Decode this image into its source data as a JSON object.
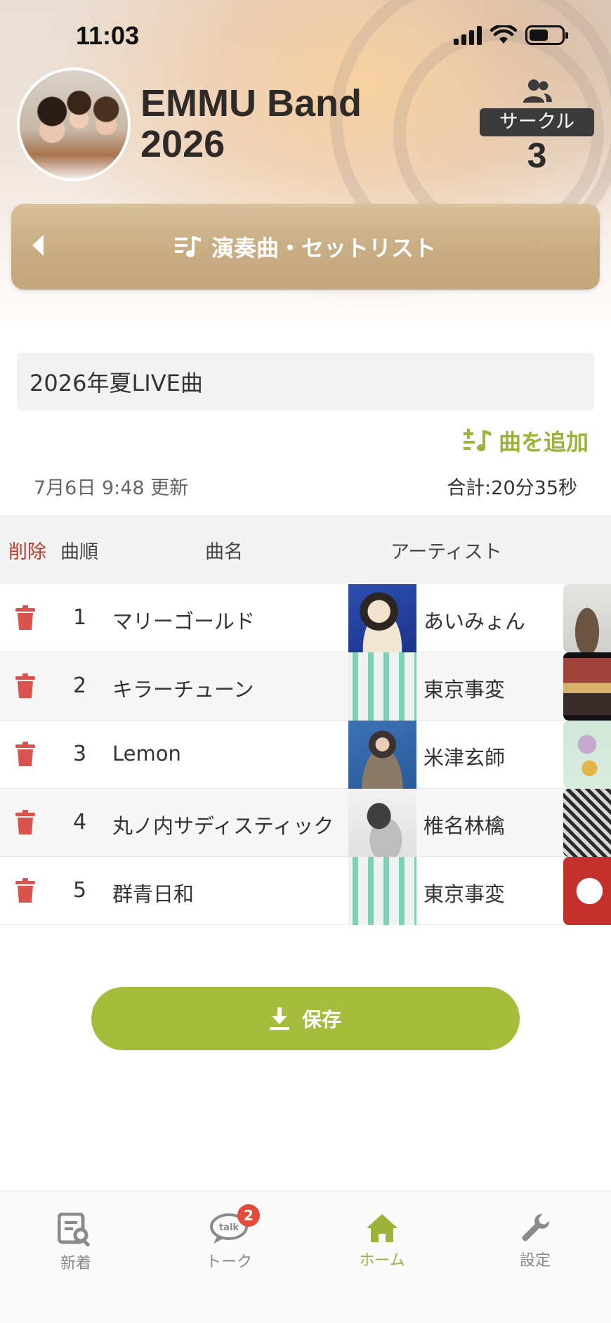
{
  "status_bar": {
    "time": "11:03"
  },
  "header": {
    "band_name_line1": "EMMU Band",
    "band_name_line2": "2026",
    "circle_label": "サークル",
    "circle_count": "3"
  },
  "banner": {
    "title": "演奏曲・セットリスト"
  },
  "setlist": {
    "name": "2026年夏LIVE曲",
    "add_song_label": "曲を追加",
    "updated": "7月6日 9:48 更新",
    "total": "合計:20分35秒"
  },
  "table": {
    "headers": {
      "delete": "削除",
      "order": "曲順",
      "song": "曲名",
      "artist": "アーティスト"
    },
    "rows": [
      {
        "order": "1",
        "song": "マリーゴールド",
        "artist": "あいみょん"
      },
      {
        "order": "2",
        "song": "キラーチューン",
        "artist": "東京事変"
      },
      {
        "order": "3",
        "song": "Lemon",
        "artist": "米津玄師"
      },
      {
        "order": "4",
        "song": "丸ノ内サディスティック",
        "artist": "椎名林檎"
      },
      {
        "order": "5",
        "song": "群青日和",
        "artist": "東京事変"
      }
    ]
  },
  "save_button": {
    "label": "保存"
  },
  "tabbar": {
    "items": [
      {
        "label": "新着",
        "icon": "news-search-icon"
      },
      {
        "label": "トーク",
        "icon": "talk-bubble-icon",
        "badge": "2"
      },
      {
        "label": "ホーム",
        "icon": "home-icon",
        "active": true
      },
      {
        "label": "設定",
        "icon": "wrench-icon"
      }
    ]
  },
  "colors": {
    "accent": "#a5bd3a",
    "delete": "#d9534f",
    "banner": "#c9ad84",
    "badge": "#e24a3b"
  }
}
